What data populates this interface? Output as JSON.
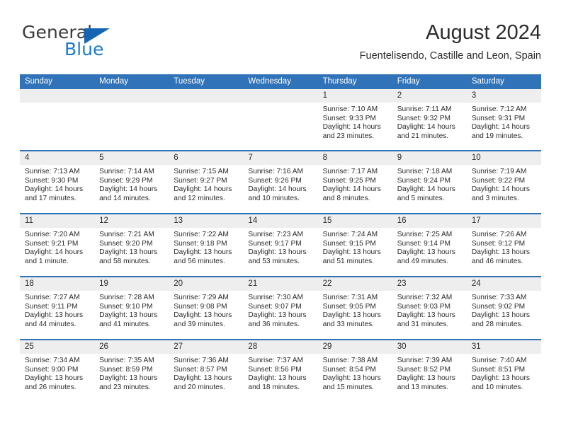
{
  "brand": {
    "name_top": "General",
    "name_bottom": "Blue",
    "accent_color": "#1565b5",
    "text_color": "#3a3a3a"
  },
  "header": {
    "title": "August 2024",
    "location": "Fuentelisendo, Castille and Leon, Spain",
    "header_blue": "#3173b8",
    "day_band_gray": "#eeeeee"
  },
  "calendar": {
    "day_names": [
      "Sunday",
      "Monday",
      "Tuesday",
      "Wednesday",
      "Thursday",
      "Friday",
      "Saturday"
    ],
    "weeks": [
      [
        {
          "day": "",
          "sunrise": "",
          "sunset": "",
          "daylight": ""
        },
        {
          "day": "",
          "sunrise": "",
          "sunset": "",
          "daylight": ""
        },
        {
          "day": "",
          "sunrise": "",
          "sunset": "",
          "daylight": ""
        },
        {
          "day": "",
          "sunrise": "",
          "sunset": "",
          "daylight": ""
        },
        {
          "day": "1",
          "sunrise": "Sunrise: 7:10 AM",
          "sunset": "Sunset: 9:33 PM",
          "daylight": "Daylight: 14 hours and 23 minutes."
        },
        {
          "day": "2",
          "sunrise": "Sunrise: 7:11 AM",
          "sunset": "Sunset: 9:32 PM",
          "daylight": "Daylight: 14 hours and 21 minutes."
        },
        {
          "day": "3",
          "sunrise": "Sunrise: 7:12 AM",
          "sunset": "Sunset: 9:31 PM",
          "daylight": "Daylight: 14 hours and 19 minutes."
        }
      ],
      [
        {
          "day": "4",
          "sunrise": "Sunrise: 7:13 AM",
          "sunset": "Sunset: 9:30 PM",
          "daylight": "Daylight: 14 hours and 17 minutes."
        },
        {
          "day": "5",
          "sunrise": "Sunrise: 7:14 AM",
          "sunset": "Sunset: 9:29 PM",
          "daylight": "Daylight: 14 hours and 14 minutes."
        },
        {
          "day": "6",
          "sunrise": "Sunrise: 7:15 AM",
          "sunset": "Sunset: 9:27 PM",
          "daylight": "Daylight: 14 hours and 12 minutes."
        },
        {
          "day": "7",
          "sunrise": "Sunrise: 7:16 AM",
          "sunset": "Sunset: 9:26 PM",
          "daylight": "Daylight: 14 hours and 10 minutes."
        },
        {
          "day": "8",
          "sunrise": "Sunrise: 7:17 AM",
          "sunset": "Sunset: 9:25 PM",
          "daylight": "Daylight: 14 hours and 8 minutes."
        },
        {
          "day": "9",
          "sunrise": "Sunrise: 7:18 AM",
          "sunset": "Sunset: 9:24 PM",
          "daylight": "Daylight: 14 hours and 5 minutes."
        },
        {
          "day": "10",
          "sunrise": "Sunrise: 7:19 AM",
          "sunset": "Sunset: 9:22 PM",
          "daylight": "Daylight: 14 hours and 3 minutes."
        }
      ],
      [
        {
          "day": "11",
          "sunrise": "Sunrise: 7:20 AM",
          "sunset": "Sunset: 9:21 PM",
          "daylight": "Daylight: 14 hours and 1 minute."
        },
        {
          "day": "12",
          "sunrise": "Sunrise: 7:21 AM",
          "sunset": "Sunset: 9:20 PM",
          "daylight": "Daylight: 13 hours and 58 minutes."
        },
        {
          "day": "13",
          "sunrise": "Sunrise: 7:22 AM",
          "sunset": "Sunset: 9:18 PM",
          "daylight": "Daylight: 13 hours and 56 minutes."
        },
        {
          "day": "14",
          "sunrise": "Sunrise: 7:23 AM",
          "sunset": "Sunset: 9:17 PM",
          "daylight": "Daylight: 13 hours and 53 minutes."
        },
        {
          "day": "15",
          "sunrise": "Sunrise: 7:24 AM",
          "sunset": "Sunset: 9:15 PM",
          "daylight": "Daylight: 13 hours and 51 minutes."
        },
        {
          "day": "16",
          "sunrise": "Sunrise: 7:25 AM",
          "sunset": "Sunset: 9:14 PM",
          "daylight": "Daylight: 13 hours and 49 minutes."
        },
        {
          "day": "17",
          "sunrise": "Sunrise: 7:26 AM",
          "sunset": "Sunset: 9:12 PM",
          "daylight": "Daylight: 13 hours and 46 minutes."
        }
      ],
      [
        {
          "day": "18",
          "sunrise": "Sunrise: 7:27 AM",
          "sunset": "Sunset: 9:11 PM",
          "daylight": "Daylight: 13 hours and 44 minutes."
        },
        {
          "day": "19",
          "sunrise": "Sunrise: 7:28 AM",
          "sunset": "Sunset: 9:10 PM",
          "daylight": "Daylight: 13 hours and 41 minutes."
        },
        {
          "day": "20",
          "sunrise": "Sunrise: 7:29 AM",
          "sunset": "Sunset: 9:08 PM",
          "daylight": "Daylight: 13 hours and 39 minutes."
        },
        {
          "day": "21",
          "sunrise": "Sunrise: 7:30 AM",
          "sunset": "Sunset: 9:07 PM",
          "daylight": "Daylight: 13 hours and 36 minutes."
        },
        {
          "day": "22",
          "sunrise": "Sunrise: 7:31 AM",
          "sunset": "Sunset: 9:05 PM",
          "daylight": "Daylight: 13 hours and 33 minutes."
        },
        {
          "day": "23",
          "sunrise": "Sunrise: 7:32 AM",
          "sunset": "Sunset: 9:03 PM",
          "daylight": "Daylight: 13 hours and 31 minutes."
        },
        {
          "day": "24",
          "sunrise": "Sunrise: 7:33 AM",
          "sunset": "Sunset: 9:02 PM",
          "daylight": "Daylight: 13 hours and 28 minutes."
        }
      ],
      [
        {
          "day": "25",
          "sunrise": "Sunrise: 7:34 AM",
          "sunset": "Sunset: 9:00 PM",
          "daylight": "Daylight: 13 hours and 26 minutes."
        },
        {
          "day": "26",
          "sunrise": "Sunrise: 7:35 AM",
          "sunset": "Sunset: 8:59 PM",
          "daylight": "Daylight: 13 hours and 23 minutes."
        },
        {
          "day": "27",
          "sunrise": "Sunrise: 7:36 AM",
          "sunset": "Sunset: 8:57 PM",
          "daylight": "Daylight: 13 hours and 20 minutes."
        },
        {
          "day": "28",
          "sunrise": "Sunrise: 7:37 AM",
          "sunset": "Sunset: 8:56 PM",
          "daylight": "Daylight: 13 hours and 18 minutes."
        },
        {
          "day": "29",
          "sunrise": "Sunrise: 7:38 AM",
          "sunset": "Sunset: 8:54 PM",
          "daylight": "Daylight: 13 hours and 15 minutes."
        },
        {
          "day": "30",
          "sunrise": "Sunrise: 7:39 AM",
          "sunset": "Sunset: 8:52 PM",
          "daylight": "Daylight: 13 hours and 13 minutes."
        },
        {
          "day": "31",
          "sunrise": "Sunrise: 7:40 AM",
          "sunset": "Sunset: 8:51 PM",
          "daylight": "Daylight: 13 hours and 10 minutes."
        }
      ]
    ]
  }
}
